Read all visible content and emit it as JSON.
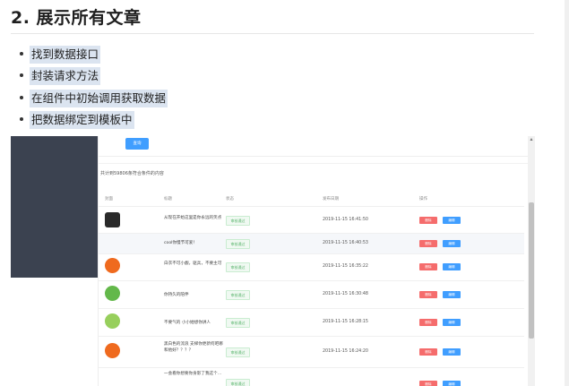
{
  "heading": "2. 展示所有文章",
  "bullets": [
    {
      "text": "找到数据接口",
      "selected": true
    },
    {
      "text": "封装请求方法",
      "selected": true
    },
    {
      "text": "在组件中初始调用获取数据",
      "selected": true
    },
    {
      "text": "把数据绑定到模板中",
      "selected": true
    }
  ],
  "app": {
    "search_label": "查询",
    "result_count": "共计到59806条符合条件的内容",
    "columns": {
      "cover": "封面",
      "title": "标题",
      "status": "状态",
      "date": "发布日期",
      "actions": "操作"
    },
    "rows": [
      {
        "avatar": "dark",
        "title": "从现在开始这里是你永远的笑点",
        "status": "审核通过",
        "date": "2019-11-15 16:41:50",
        "delete": "删除",
        "edit": "编辑"
      },
      {
        "avatar": "none",
        "title": "cool你慢节可爱！",
        "status": "审核通过",
        "date": "2019-11-15 16:40:53",
        "delete": "删除",
        "edit": "编辑"
      },
      {
        "avatar": "orange",
        "title": "白衣不可小觑，驱兵，不要主可",
        "status": "审核通过",
        "date": "2019-11-15 16:35:22",
        "delete": "删除",
        "edit": "编辑"
      },
      {
        "avatar": "green",
        "title": "你持久的陪伴",
        "status": "审核通过",
        "date": "2019-11-15 16:30:48",
        "delete": "删除",
        "edit": "编辑"
      },
      {
        "avatar": "lime",
        "title": "不要气的 小小她想你讲人",
        "status": "审核通过",
        "date": "2019-11-15 16:28:15",
        "delete": "删除",
        "edit": "编辑"
      },
      {
        "avatar": "orange",
        "title": "黑白色的流浪 支梯你更新何吧哪和他好？？？？",
        "status": "审核通过",
        "date": "2019-11-15 16:24:20",
        "delete": "删除",
        "edit": "编辑"
      },
      {
        "avatar": "none",
        "title": "一会看你想要你身影了我这个…",
        "status": "审核通过",
        "date": "",
        "delete": "删除",
        "edit": "编辑"
      }
    ]
  }
}
